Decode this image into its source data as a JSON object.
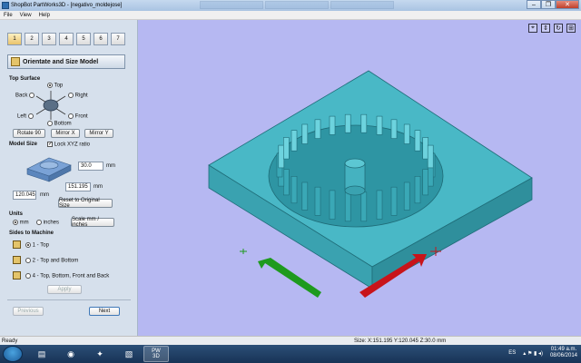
{
  "window": {
    "title": "ShopBot PartWorks3D - [negativo_moldejose]",
    "controls": [
      "–",
      "❐",
      "✕"
    ]
  },
  "menu": [
    "File",
    "View",
    "Help"
  ],
  "panel": {
    "toolbar": [
      "1",
      "2",
      "3",
      "4",
      "5",
      "6",
      "7"
    ],
    "stage_title": "Orientate and Size Model",
    "top_surface": {
      "heading": "Top Surface",
      "options": {
        "top": "Top",
        "back": "Back",
        "right": "Right",
        "left": "Left",
        "front": "Front",
        "bottom": "Bottom"
      },
      "selected": "Top",
      "buttons": {
        "rotate": "Rotate 90",
        "mirror_x": "Mirror X",
        "mirror_y": "Mirror Y"
      }
    },
    "model_size": {
      "heading": "Model Size",
      "lock_label": "Lock XYZ ratio",
      "lock_checked": true,
      "z_value": "30.0",
      "x_value": "151.195",
      "y_value": "120.045",
      "unit": "mm",
      "reset_label": "Reset to Original Size"
    },
    "units": {
      "heading": "Units",
      "mm": "mm",
      "inches": "inches",
      "selected": "mm",
      "scale_label": "Scale mm / inches"
    },
    "sides": {
      "heading": "Sides to Machine",
      "options": [
        "1 - Top",
        "2 - Top and Bottom",
        "4 - Top, Bottom, Front and Back"
      ],
      "selected_index": 0,
      "apply_label": "Apply"
    },
    "nav": {
      "previous": "Previous",
      "next": "Next"
    }
  },
  "viewport": {
    "background": "#b6b8f2",
    "model_color": "#3fb8c8",
    "x_arrow_color": "#c8141a",
    "y_arrow_color": "#1e9a1e",
    "view_buttons": [
      "⌖",
      "⇕",
      "↻",
      "⊞"
    ]
  },
  "status": {
    "left": "Ready",
    "size": "Size: X:151.195 Y:120.045 Z:30.0 mm"
  },
  "taskbar": {
    "apps": [
      "folder",
      "chrome",
      "shopbot-pw3d",
      "photo",
      "pw3d"
    ],
    "pw3d_label": "PW\n3D",
    "lang": "ES",
    "time": "01:49 a.m.",
    "date": "08/06/2014"
  }
}
